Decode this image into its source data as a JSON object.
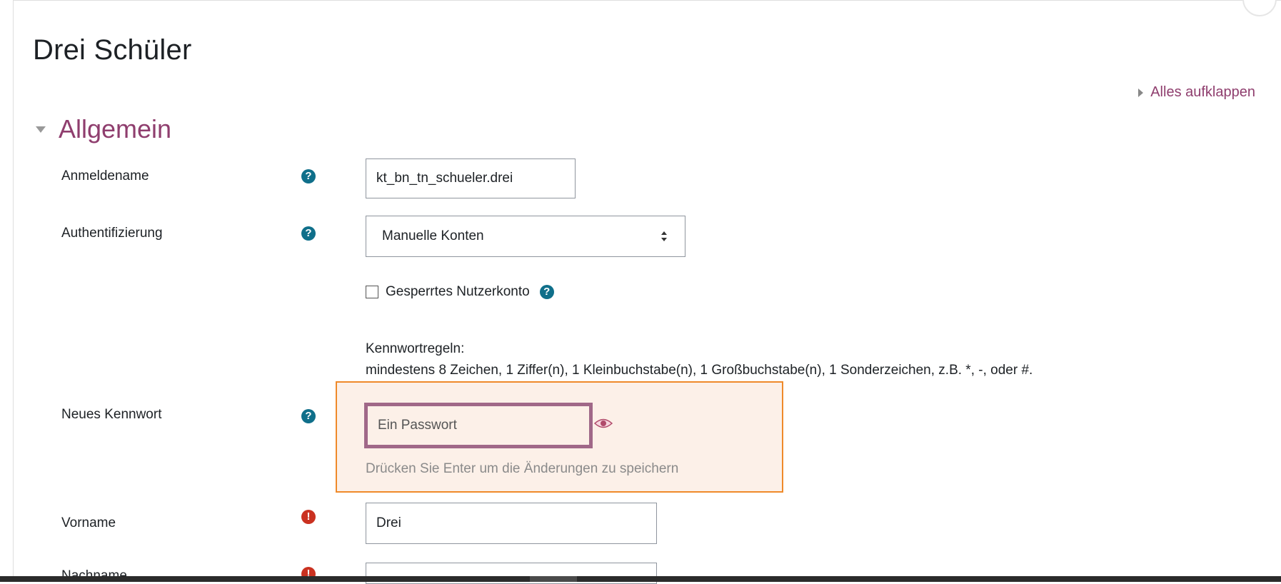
{
  "page": {
    "title": "Drei Schüler"
  },
  "toolbar": {
    "expand_all_label": "Alles aufklappen"
  },
  "section": {
    "title": "Allgemein"
  },
  "fields": {
    "username": {
      "label": "Anmeldename",
      "value": "kt_bn_tn_schueler.drei"
    },
    "auth": {
      "label": "Authentifizierung",
      "selected": "Manuelle Konten"
    },
    "suspended": {
      "label": "Gesperrtes Nutzerkonto",
      "checked": false
    },
    "password_rules": {
      "heading": "Kennwortregeln:",
      "text": "mindestens 8 Zeichen, 1 Ziffer(n), 1 Kleinbuchstabe(n), 1 Großbuchstabe(n), 1 Sonderzeichen, z.B. *, -, oder #."
    },
    "new_password": {
      "label": "Neues Kennwort",
      "value": "Ein Passwort",
      "hint": "Drücken Sie Enter um die Änderungen zu speichern"
    },
    "firstname": {
      "label": "Vorname",
      "value": "Drei"
    },
    "lastname": {
      "label": "Nachname",
      "value": ""
    }
  },
  "icons": {
    "help": "question-circle-icon",
    "required": "exclamation-circle-icon",
    "reveal": "eye-icon"
  },
  "colors": {
    "accent": "#8f3e6e",
    "help_icon": "#0f6f8a",
    "required_icon": "#ca3120",
    "highlight_border": "#ef8a2a",
    "highlight_fill": "#fcf0e8"
  }
}
